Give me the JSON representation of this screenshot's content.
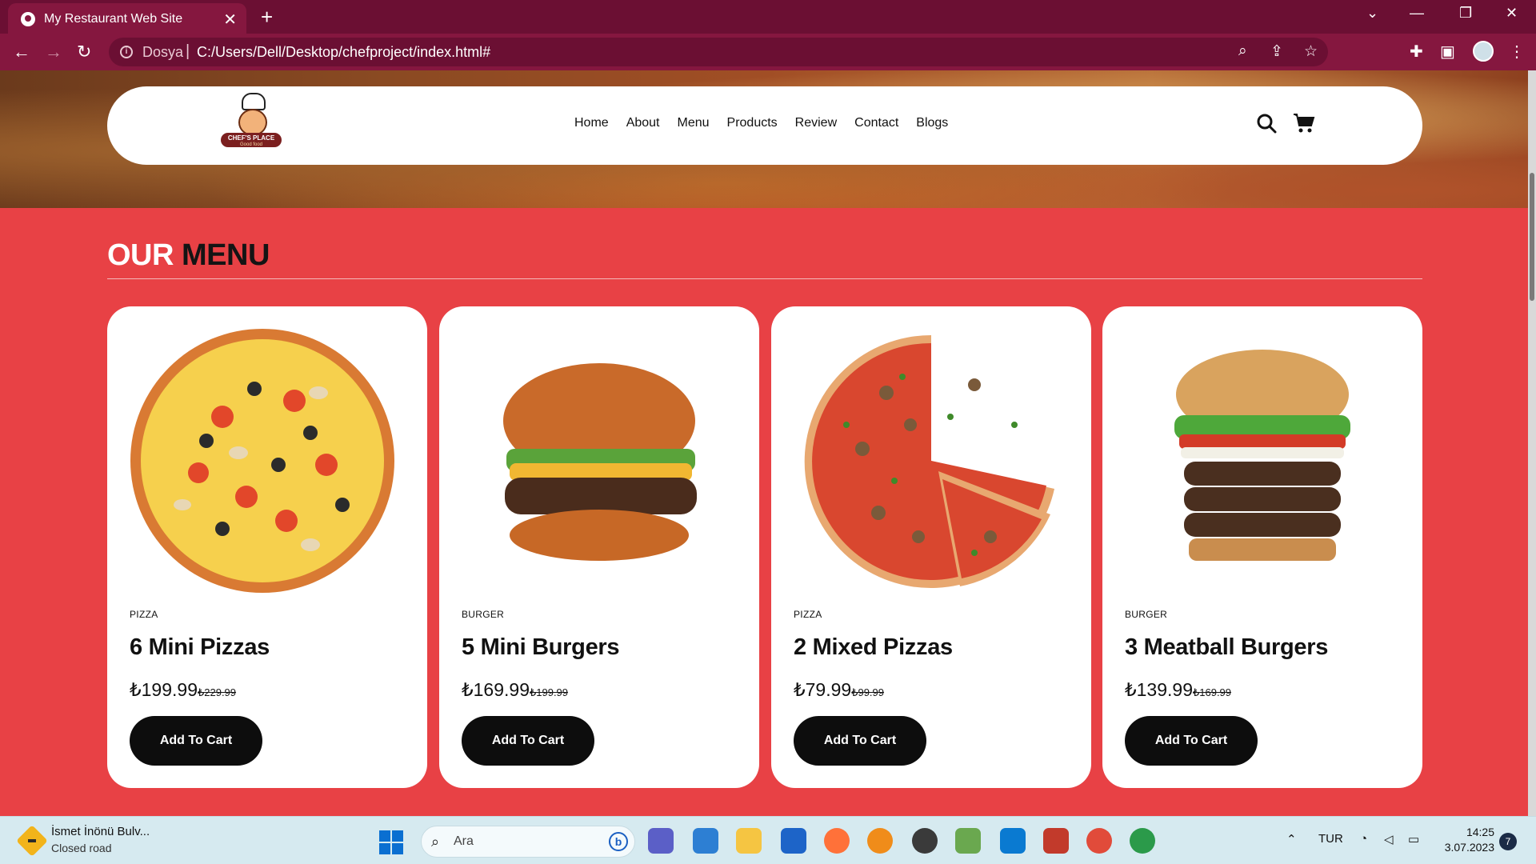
{
  "browser": {
    "tab_title": "My Restaurant Web Site",
    "tab_close": "✕",
    "new_tab": "+",
    "scheme_label": "Dosya",
    "separator": "|",
    "url": "C:/Users/Dell/Desktop/chefproject/index.html#",
    "window_controls": [
      "⌄",
      "—",
      "❐",
      "✕"
    ]
  },
  "site": {
    "logo_text": "CHEF'S PLACE",
    "logo_sub": "Good food",
    "nav": [
      "Home",
      "About",
      "Menu",
      "Products",
      "Review",
      "Contact",
      "Blogs"
    ],
    "section_title_part1": "OUR",
    "section_title_part2": "MENU",
    "cards": [
      {
        "category": "PIZZA",
        "name": "6 Mini Pizzas",
        "price": "₺199.99",
        "old_price": "₺229.99",
        "button": "Add To Cart"
      },
      {
        "category": "BURGER",
        "name": "5 Mini Burgers",
        "price": "₺169.99",
        "old_price": "₺199.99",
        "button": "Add To Cart"
      },
      {
        "category": "PIZZA",
        "name": "2 Mixed Pizzas",
        "price": "₺79.99",
        "old_price": "₺99.99",
        "button": "Add To Cart"
      },
      {
        "category": "BURGER",
        "name": "3 Meatball Burgers",
        "price": "₺139.99",
        "old_price": "₺169.99",
        "button": "Add To Cart"
      }
    ]
  },
  "colors": {
    "page_bg": "#e84145",
    "tabbar": "#6b0f33",
    "toolbar": "#85173f",
    "button_bg": "#0d0d0d"
  },
  "taskbar": {
    "weather_title": "İsmet İnönü Bulv...",
    "weather_sub": "Closed road",
    "search_placeholder": "Ara",
    "language": "TUR",
    "time": "14:25",
    "date": "3.07.2023",
    "notifications": "7"
  }
}
